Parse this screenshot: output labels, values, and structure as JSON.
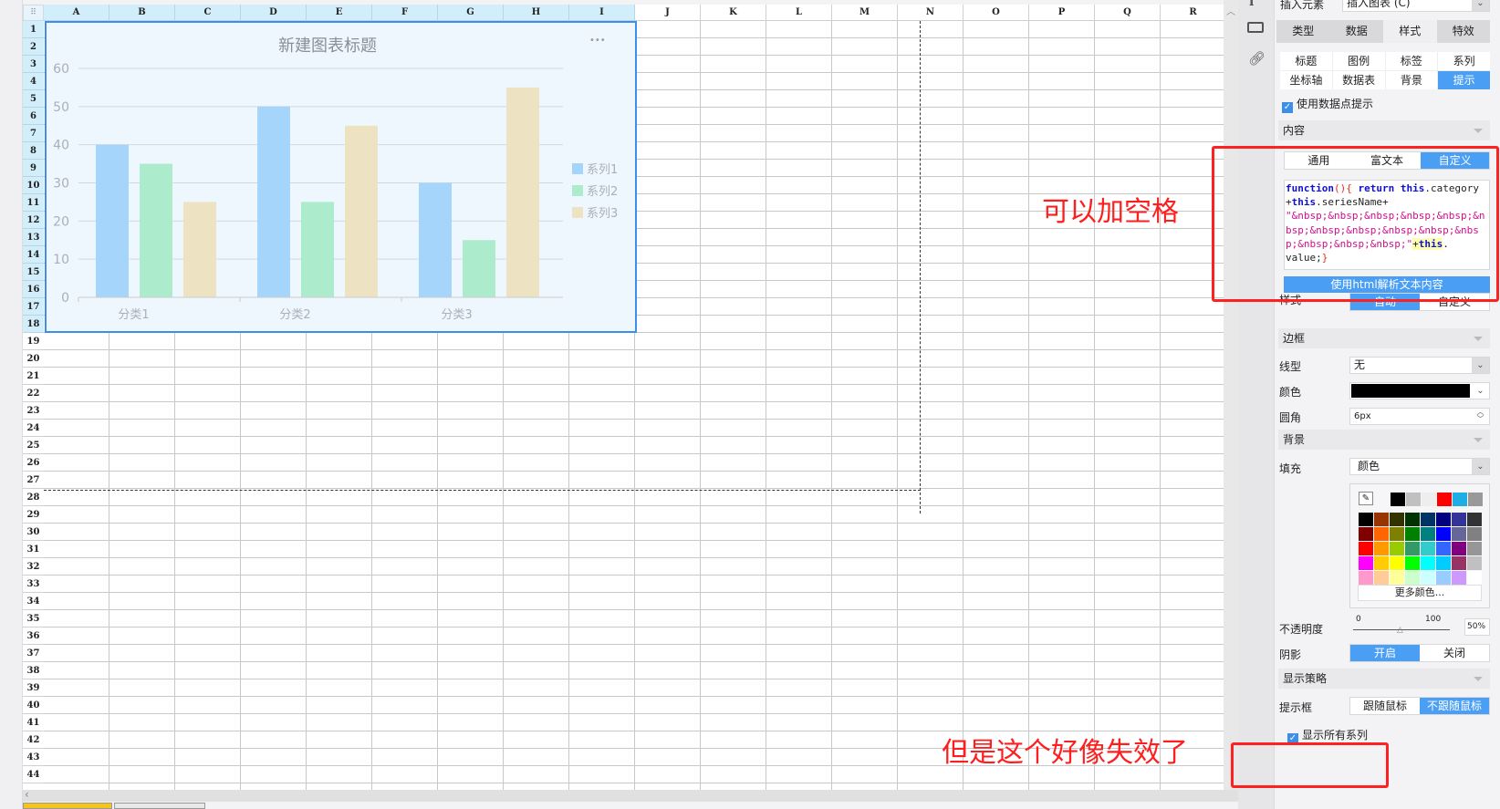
{
  "sheet": {
    "columns": [
      "A",
      "B",
      "C",
      "D",
      "E",
      "F",
      "G",
      "H",
      "I",
      "J",
      "K",
      "L",
      "M",
      "N",
      "O",
      "P",
      "Q",
      "R"
    ],
    "rows": [
      "1",
      "2",
      "3",
      "4",
      "5",
      "6",
      "7",
      "8",
      "9",
      "10",
      "11",
      "12",
      "13",
      "14",
      "15",
      "16",
      "17",
      "18",
      "19",
      "20",
      "21",
      "22",
      "23",
      "24",
      "25",
      "26",
      "27",
      "28",
      "29",
      "30",
      "31",
      "32",
      "33",
      "34",
      "35",
      "36",
      "37",
      "38",
      "39",
      "40",
      "41",
      "42",
      "43",
      "44"
    ],
    "corner_icon": "grid-icon"
  },
  "chart_data": {
    "type": "bar",
    "title": "新建图表标题",
    "menu_label": "•••",
    "categories": [
      "分类1",
      "分类2",
      "分类3"
    ],
    "series": [
      {
        "name": "系列1",
        "values": [
          40,
          50,
          30
        ],
        "color": "#a5d5fa"
      },
      {
        "name": "系列2",
        "values": [
          35,
          25,
          15
        ],
        "color": "#acebcb"
      },
      {
        "name": "系列3",
        "values": [
          25,
          45,
          55
        ],
        "color": "#ede3c3"
      }
    ],
    "yticks": [
      "0",
      "10",
      "20",
      "30",
      "40",
      "50",
      "60"
    ],
    "ylim": [
      0,
      60
    ],
    "legend": "right",
    "grid": true
  },
  "panel": {
    "insert_label": "插入元素",
    "insert_value": "插入图表 (C)",
    "tabs": [
      "类型",
      "数据",
      "样式",
      "特效"
    ],
    "subtabs": [
      "标题",
      "图例",
      "标签",
      "系列",
      "坐标轴",
      "数据表",
      "背景",
      "提示"
    ],
    "use_tooltip": "使用数据点提示",
    "content_section": "内容",
    "content_modes": [
      "通用",
      "富文本",
      "自定义"
    ],
    "code": {
      "p1": "function",
      "p2": "(){",
      "p3": " return ",
      "p4": "this",
      ".cat": ".category\n+",
      "p5": "this",
      ".sn": ".seriesName+\n",
      "str": "\"&nbsp;&nbsp;&nbsp;&nbsp;&nbsp;&nbsp;&nbsp;&nbsp;&nbsp;&nbsp;&nbsp;&nbsp;&nbsp;&nbsp;\"",
      "plus": "+",
      "p6": "this",
      "tail": ".\nvalue;",
      "end": "}"
    },
    "html_button": "使用html解析文本内容",
    "style_label": "样式",
    "style_options": [
      "自动",
      "自定义"
    ],
    "border_section": "边框",
    "linetype_label": "线型",
    "linetype_value": "无",
    "color_label": "颜色",
    "color_value": "#000000",
    "radius_label": "圆角",
    "radius_value": "6px",
    "bg_section": "背景",
    "fill_label": "填充",
    "fill_value": "颜色",
    "palette_top": [
      "#000000",
      "#c0c0c0",
      "#eeeeee",
      "#ff0000",
      "#1eaee4",
      "#999999"
    ],
    "palette": [
      [
        "#000000",
        "#993300",
        "#333300",
        "#003300",
        "#003366",
        "#000080",
        "#333399",
        "#333333"
      ],
      [
        "#800000",
        "#ff6600",
        "#808000",
        "#008000",
        "#008080",
        "#0000ff",
        "#666699",
        "#808080"
      ],
      [
        "#ff0000",
        "#ff9900",
        "#99cc00",
        "#339966",
        "#33cccc",
        "#3366ff",
        "#800080",
        "#969696"
      ],
      [
        "#ff00ff",
        "#ffcc00",
        "#ffff00",
        "#00ff00",
        "#00ffff",
        "#00ccff",
        "#993366",
        "#c0c0c0"
      ],
      [
        "#ff99cc",
        "#ffcc99",
        "#ffff99",
        "#ccffcc",
        "#ccffff",
        "#99ccff",
        "#cc99ff",
        "#ffffff"
      ]
    ],
    "more_colors": "更多颜色...",
    "opacity_label": "不透明度",
    "opacity_min": "0",
    "opacity_max": "100",
    "opacity_value": "50%",
    "opacity_fraction": 0.5,
    "shadow_label": "阴影",
    "shadow_options": [
      "开启",
      "关闭"
    ],
    "strategy_section": "显示策略",
    "tipbox_label": "提示框",
    "tipbox_options": [
      "跟随鼠标",
      "不跟随鼠标"
    ],
    "show_all_series": "显示所有系列"
  },
  "annotations": {
    "note1": "可以加空格",
    "note2": "但是这个好像失效了"
  }
}
